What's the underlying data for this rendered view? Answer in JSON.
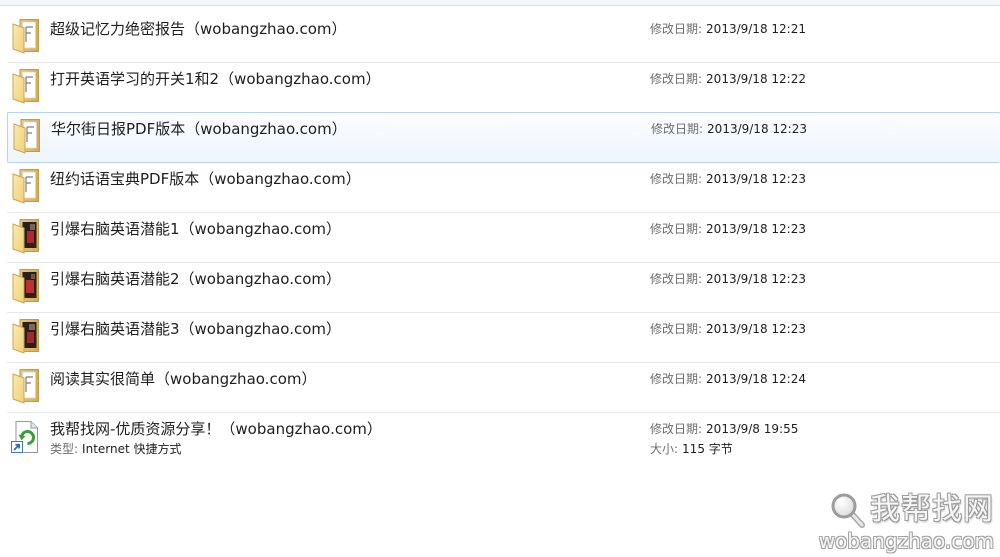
{
  "items": [
    {
      "name": "超级记忆力绝密报告（wobangzhao.com）",
      "icon": "folder-icon",
      "date_label": "修改日期:",
      "date": "2013/9/18 12:21"
    },
    {
      "name": "打开英语学习的开关1和2（wobangzhao.com）",
      "icon": "folder-icon",
      "date_label": "修改日期:",
      "date": "2013/9/18 12:22"
    },
    {
      "name": "华尔街日报PDF版本（wobangzhao.com）",
      "icon": "folder-icon",
      "date_label": "修改日期:",
      "date": "2013/9/18 12:23",
      "state": "hover"
    },
    {
      "name": "纽约话语宝典PDF版本（wobangzhao.com）",
      "icon": "folder-icon",
      "date_label": "修改日期:",
      "date": "2013/9/18 12:23"
    },
    {
      "name": "引爆右脑英语潜能1（wobangzhao.com）",
      "icon": "folder-with-images-icon",
      "date_label": "修改日期:",
      "date": "2013/9/18 12:23"
    },
    {
      "name": "引爆右脑英语潜能2（wobangzhao.com）",
      "icon": "folder-with-images-icon",
      "date_label": "修改日期:",
      "date": "2013/9/18 12:23"
    },
    {
      "name": "引爆右脑英语潜能3（wobangzhao.com）",
      "icon": "folder-with-images-icon",
      "date_label": "修改日期:",
      "date": "2013/9/18 12:23"
    },
    {
      "name": "阅读其实很简单（wobangzhao.com）",
      "icon": "folder-icon",
      "date_label": "修改日期:",
      "date": "2013/9/18 12:24"
    },
    {
      "name": "我帮找网-优质资源分享！（wobangzhao.com）",
      "icon": "internet-shortcut-icon",
      "date_label": "修改日期:",
      "date": "2013/9/8 19:55",
      "type_label": "类型:",
      "type": "Internet 快捷方式",
      "size_label": "大小:",
      "size": "115 字节"
    }
  ],
  "watermark": {
    "brand": "我帮找网",
    "domain": "wobangzhao.com",
    "icon": "magnifier-icon"
  },
  "colors": {
    "hover_border": "#b5d3f3",
    "hover_fill": "#eef5fd",
    "label_gray": "#6d6d6d",
    "text": "#1e1e1e",
    "separator": "#e8e8e8",
    "folder": "#f2d58a"
  }
}
